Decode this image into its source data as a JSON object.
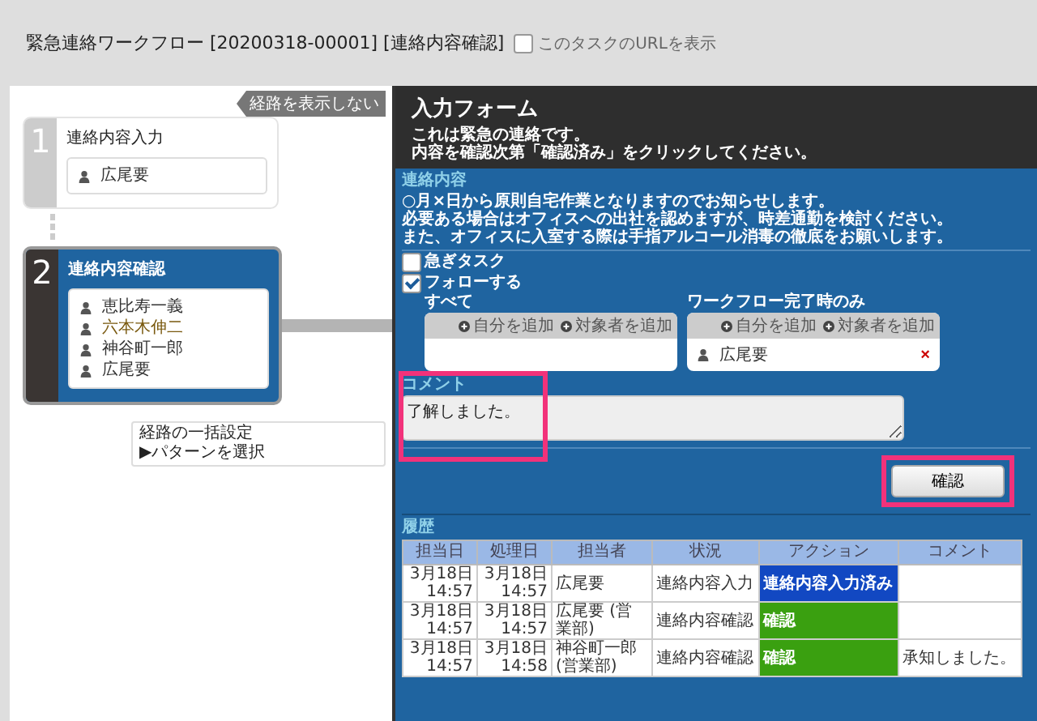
{
  "header": {
    "title": "緊急連絡ワークフロー [20200318-00001] [連絡内容確認]",
    "url_toggle": {
      "label": "このタスクのURLを表示",
      "checked": false
    }
  },
  "route": {
    "toggle": "経路を表示しない",
    "steps": [
      {
        "number": "1",
        "name": "連絡内容入力",
        "selected": false,
        "people": [
          {
            "name": "広尾要",
            "color": "#333333"
          }
        ]
      },
      {
        "number": "2",
        "name": "連絡内容確認",
        "selected": true,
        "people": [
          {
            "name": "恵比寿一義",
            "color": "#333333"
          },
          {
            "name": "六本木伸二",
            "color": "#7a5a10"
          },
          {
            "name": "神谷町一郎",
            "color": "#333333"
          },
          {
            "name": "広尾要",
            "color": "#333333"
          }
        ]
      }
    ],
    "bulk": {
      "title": "経路の一括設定",
      "link": "▶パターンを選択"
    }
  },
  "form": {
    "title": "入力フォーム",
    "intro": [
      "これは緊急の連絡です。",
      "内容を確認次第「確認済み」をクリックしてください。"
    ],
    "contact_label": "連絡内容",
    "contact_lines": [
      "○月×日から原則自宅作業となりますのでお知らせします。",
      "必要ある場合はオフィスへの出社を認めますが、時差通勤を検討ください。",
      "また、オフィスに入室する際は手指アルコール消毒の徹底をお願いします。"
    ],
    "checkboxes": [
      {
        "label": "急ぎタスク",
        "checked": false
      },
      {
        "label": "フォローする",
        "checked": true
      }
    ],
    "follow_groups": [
      {
        "title": "すべて",
        "actions": [
          "自分を追加",
          "対象者を追加"
        ]
      },
      {
        "title": "ワークフロー完了時のみ",
        "actions": [
          "自分を追加",
          "対象者を追加"
        ],
        "people": [
          {
            "name": "広尾要",
            "remove": "×"
          }
        ]
      }
    ],
    "comment": {
      "label": "コメント",
      "value": "了解しました。",
      "highlighted": true
    },
    "confirm_button": {
      "label": "確認",
      "highlighted": true
    }
  },
  "history": {
    "label": "履歴",
    "columns": [
      "担当日",
      "処理日",
      "担当者",
      "状況",
      "アクション",
      "コメント"
    ],
    "rows": [
      {
        "assigned": [
          "3月18日",
          "14:57"
        ],
        "processed": [
          "3月18日",
          "14:57"
        ],
        "person": "広尾要",
        "status": "連絡内容入力",
        "action": {
          "label": "連絡内容入力済み",
          "kind": "input"
        }
      },
      {
        "assigned": [
          "3月18日",
          "14:57"
        ],
        "processed": [
          "3月18日",
          "14:57"
        ],
        "person": "広尾要 (営業部)",
        "status": "連絡内容確認",
        "action": {
          "label": "確認",
          "kind": "confirm"
        }
      },
      {
        "assigned": [
          "3月18日",
          "14:57"
        ],
        "processed": [
          "3月18日",
          "14:58"
        ],
        "person": "神谷町一郎 (営業部)",
        "status": "連絡内容確認",
        "action": {
          "label": "確認",
          "kind": "confirm"
        },
        "comment": "承知しました。"
      }
    ]
  }
}
